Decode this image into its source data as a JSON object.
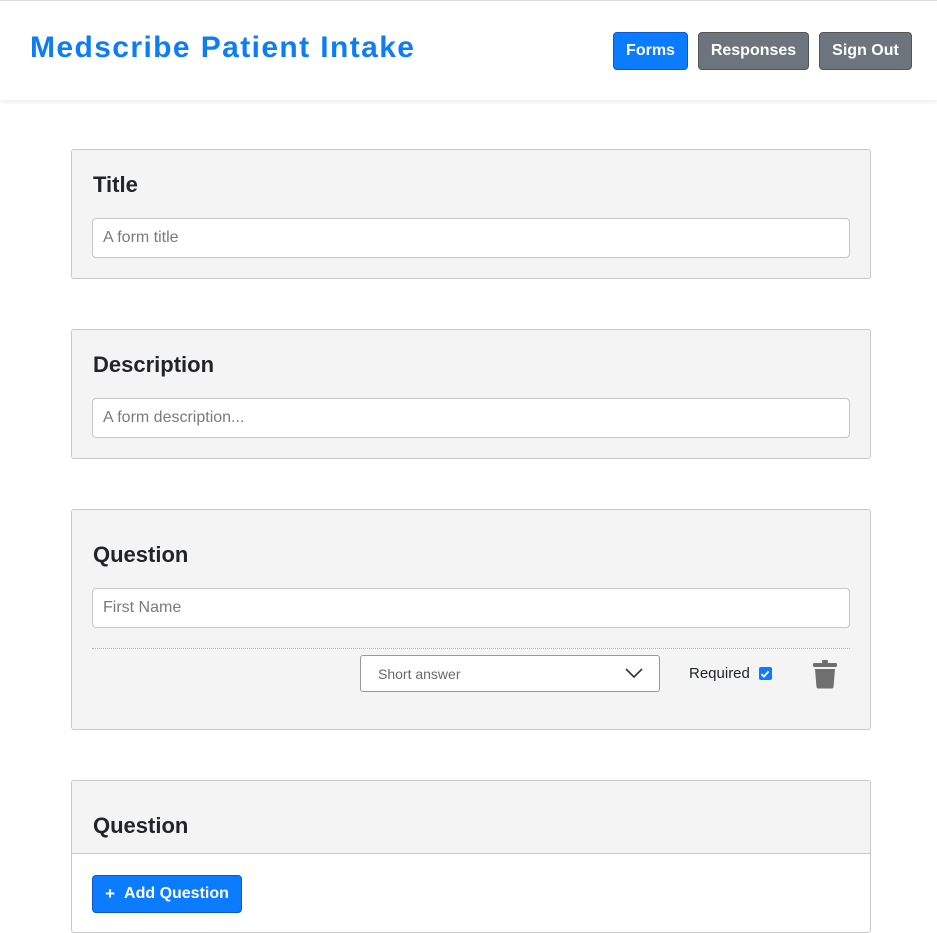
{
  "header": {
    "brand": "Medscribe Patient Intake",
    "nav": {
      "forms": "Forms",
      "responses": "Responses",
      "sign_out": "Sign Out"
    }
  },
  "title_card": {
    "heading": "Title",
    "placeholder": "A form title",
    "value": ""
  },
  "description_card": {
    "heading": "Description",
    "placeholder": "A form description...",
    "value": ""
  },
  "question_card": {
    "heading": "Question",
    "placeholder": "First Name",
    "value": "",
    "answer_type": "Short answer",
    "required_label": "Required",
    "required_checked": true
  },
  "new_question_card": {
    "heading": "Question",
    "add_button_icon": "+",
    "add_button_label": "Add Question"
  },
  "colors": {
    "brand": "#0d7df4",
    "primary_button": "#0b7cff",
    "secondary_button": "#6c757d",
    "card_background": "#f4f4f4"
  },
  "icons": {
    "select_caret": "chevron-down-icon",
    "delete": "trash-icon",
    "add": "plus-icon"
  }
}
